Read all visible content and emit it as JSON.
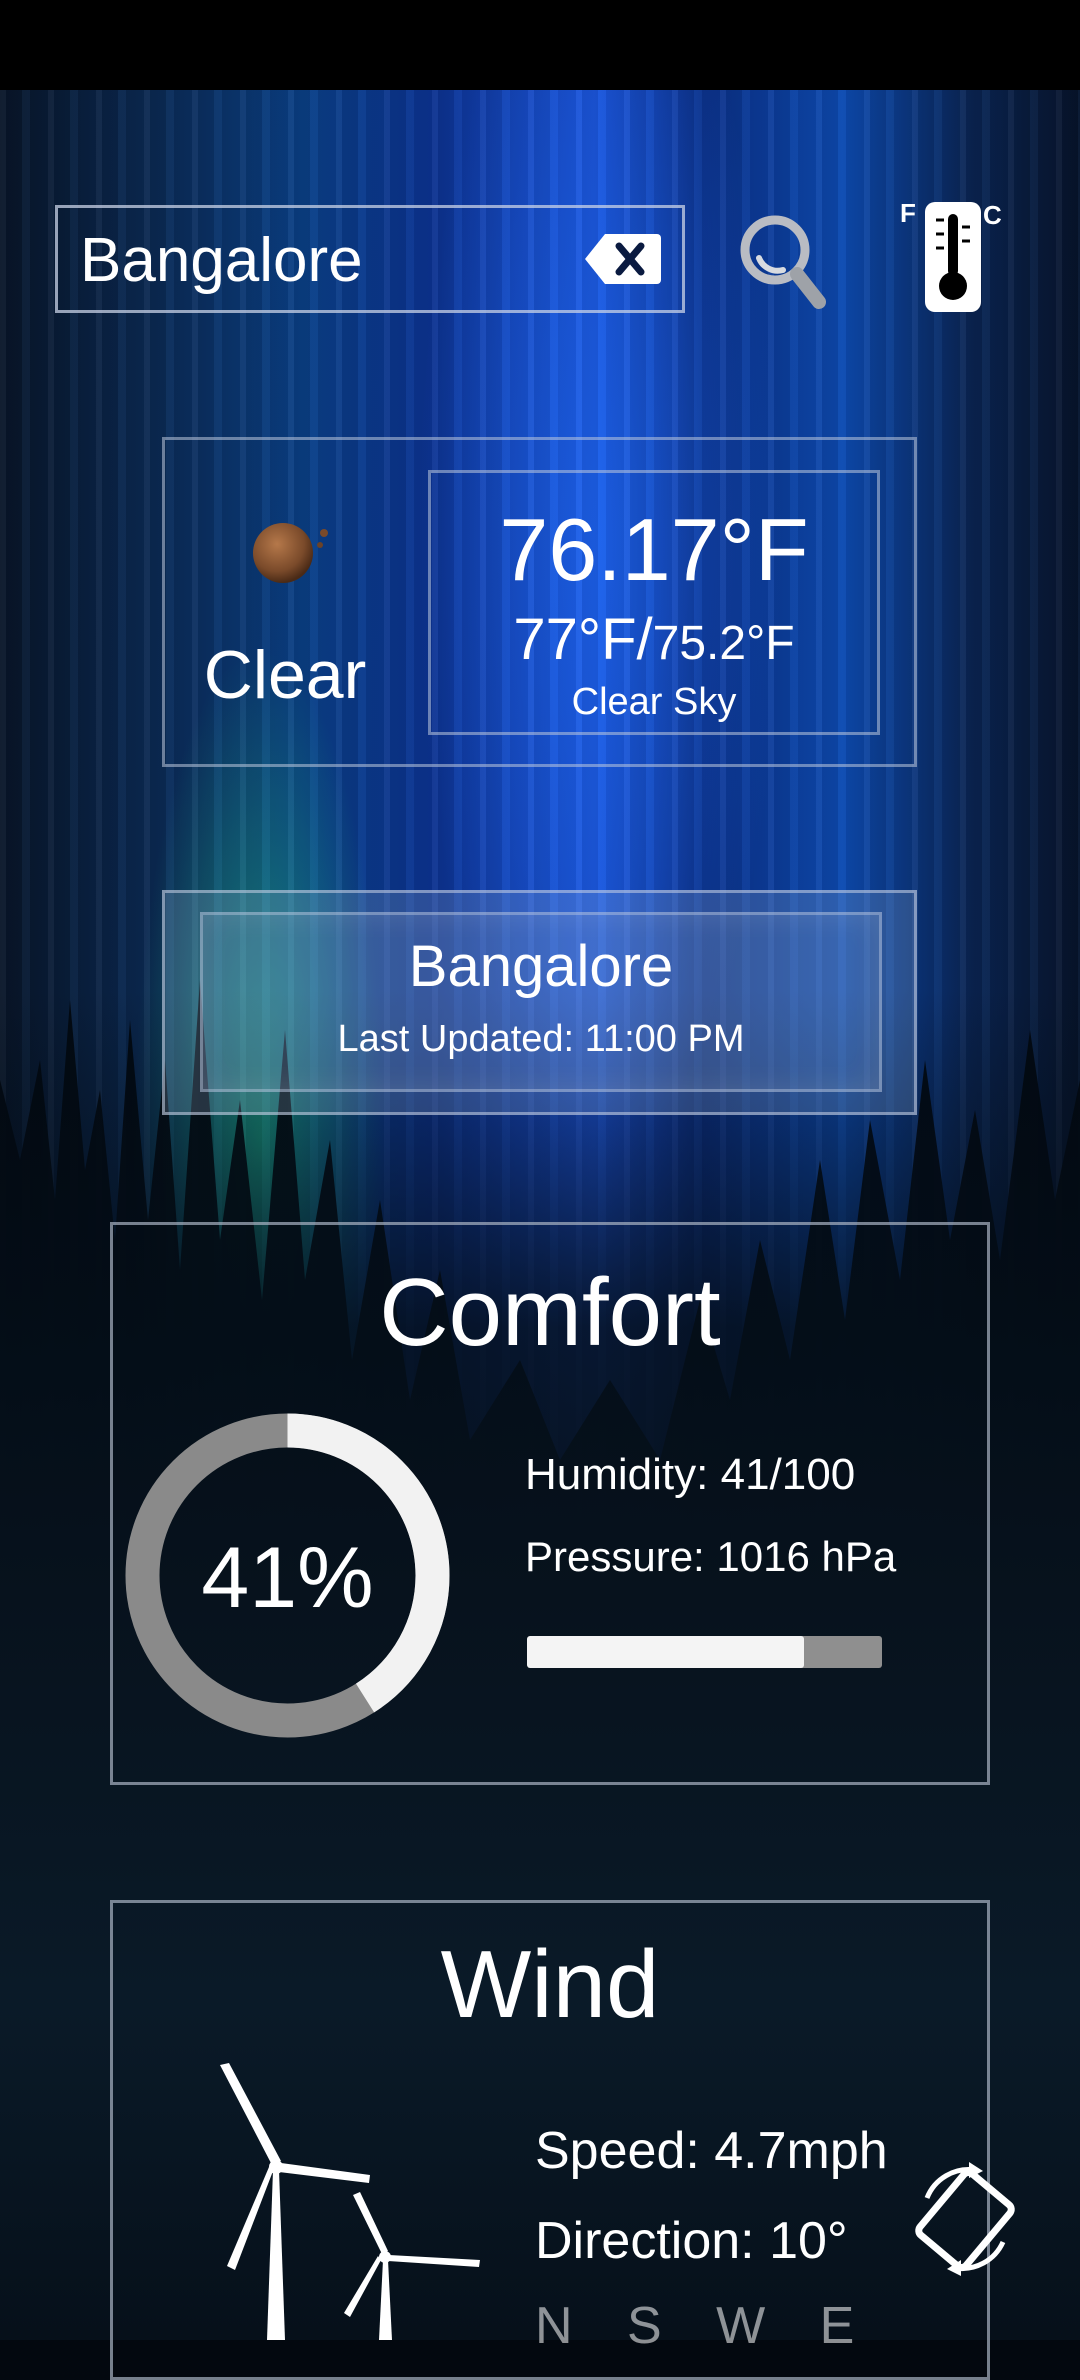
{
  "search": {
    "value": "Bangalore"
  },
  "unit_toggle": {
    "left": "F",
    "right": "C"
  },
  "current": {
    "condition": "Clear",
    "temperature": "76.17°F",
    "high": "77°F/",
    "low": "75.2°F",
    "description": "Clear Sky"
  },
  "location": {
    "city": "Bangalore",
    "last_updated": "Last Updated: 11:00 PM"
  },
  "comfort": {
    "title": "Comfort",
    "humidity_percent_label": "41%",
    "humidity_fraction": 0.41,
    "humidity": "Humidity: 41/100",
    "pressure": "Pressure: 1016 hPa",
    "pressure_bar_fraction": 0.78
  },
  "wind": {
    "title": "Wind",
    "speed": "Speed: 4.7mph",
    "direction": "Direction: 10°",
    "compass": "N S W E"
  },
  "colors": {
    "ring_track": "#8a8a8a",
    "ring_fill": "#f2f2f2",
    "bar_track": "#8f8f8f",
    "bar_fill": "#f4f4f4"
  },
  "icons": {
    "clear": "backspace-icon",
    "search": "magnifier-icon",
    "unit": "thermometer-icon",
    "weather": "moon-icon",
    "wind": "wind-turbine-icon",
    "rotate": "screen-rotate-icon"
  }
}
